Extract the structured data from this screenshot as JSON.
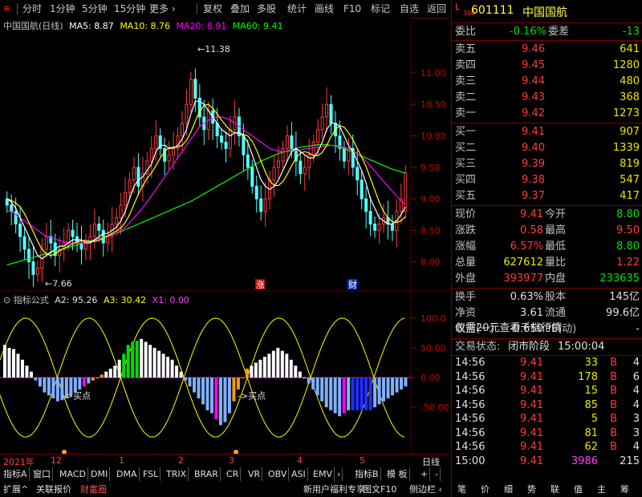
{
  "topbar": {
    "items": [
      "分时",
      "1分钟",
      "5分钟",
      "15分钟",
      "更多 ›",
      "复权",
      "叠加",
      "多股",
      "统计",
      "画线",
      "F10",
      "标记",
      "自选",
      "返回"
    ]
  },
  "chart_title": {
    "name": "中国国航(日线)",
    "ma5": "MA5: 8.87",
    "ma10": "MA10: 8.76",
    "ma20": "MA20: 8.91",
    "ma60": "MA60: 9.41",
    "color_ma5": "#ffffff",
    "color_ma10": "#ffff00",
    "color_ma20": "#ff00ff",
    "color_ma60": "#00ff00"
  },
  "price_axis": [
    "11.00",
    "10.50",
    "10.00",
    "9.50",
    "9.00",
    "8.50",
    "8.00"
  ],
  "annotations": {
    "high": "11.38",
    "low": "7.66",
    "zhang": "涨",
    "cai": "财"
  },
  "indicator": {
    "title": "指标公式",
    "a2": "A2: 95.26",
    "a3": "A3: 30.42",
    "x1": "X1: 0.00",
    "buy1": "->买点",
    "buy2": "->买点",
    "axis": [
      "100.0",
      "50.00",
      "0.00",
      "-50.00"
    ]
  },
  "dates": {
    "year": "2021年",
    "m12": "12",
    "m1": "1",
    "m2": "2",
    "m3": "3",
    "m4": "4",
    "m5": "5",
    "daily": "日线"
  },
  "bottom": {
    "row1": [
      "指标A",
      "窗口",
      "MACD",
      "DMI",
      "DMA",
      "FSL",
      "TRIX",
      "BRAR",
      "CR",
      "VR",
      "OBV",
      "ASI",
      "EMV",
      "›",
      "指标B",
      "模 板",
      "+",
      "-"
    ],
    "row2": [
      "扩展^",
      "关联报价",
      "财富圈",
      "新用户福利专享",
      "图文F10",
      "侧边栏 ‹"
    ],
    "row2_right": [
      "笔",
      "价",
      "细",
      "势",
      "联",
      "值",
      "主",
      "筹"
    ]
  },
  "quote": {
    "code": "601111",
    "name": "中国国航",
    "badge_top": "L",
    "badge_bot": "300",
    "weibi_lbl": "委比",
    "weibi": "-0.16%",
    "weicha_lbl": "委差",
    "weicha": "-13",
    "sells": [
      {
        "lbl": "卖五",
        "price": "9.46",
        "vol": "641"
      },
      {
        "lbl": "卖四",
        "price": "9.45",
        "vol": "1280"
      },
      {
        "lbl": "卖三",
        "price": "9.44",
        "vol": "480"
      },
      {
        "lbl": "卖二",
        "price": "9.43",
        "vol": "368"
      },
      {
        "lbl": "卖一",
        "price": "9.42",
        "vol": "1273"
      }
    ],
    "buys": [
      {
        "lbl": "买一",
        "price": "9.41",
        "vol": "907"
      },
      {
        "lbl": "买二",
        "price": "9.40",
        "vol": "1339"
      },
      {
        "lbl": "买三",
        "price": "9.39",
        "vol": "819"
      },
      {
        "lbl": "买四",
        "price": "9.38",
        "vol": "547"
      },
      {
        "lbl": "买五",
        "price": "9.37",
        "vol": "417"
      }
    ],
    "stats": [
      {
        "l1": "现价",
        "v1": "9.41",
        "c1": "red",
        "l2": "今开",
        "v2": "8.80",
        "c2": "green"
      },
      {
        "l1": "涨跌",
        "v1": "0.58",
        "c1": "red",
        "l2": "最高",
        "v2": "9.50",
        "c2": "red"
      },
      {
        "l1": "涨幅",
        "v1": "6.57%",
        "c1": "red",
        "l2": "最低",
        "v2": "8.80",
        "c2": "green"
      },
      {
        "l1": "总量",
        "v1": "627612",
        "c1": "yellow",
        "l2": "量比",
        "v2": "1.22",
        "c2": "red"
      },
      {
        "l1": "外盘",
        "v1": "393977",
        "c1": "red",
        "l2": "内盘",
        "v2": "233635",
        "c2": "green"
      }
    ],
    "stats2": [
      {
        "l1": "换手",
        "v1": "0.63%",
        "l2": "股本",
        "v2": "145亿"
      },
      {
        "l1": "净资",
        "v1": "3.61",
        "l2": "流通",
        "v2": "99.6亿"
      },
      {
        "l1": "收益(一)",
        "v1": "-0.650",
        "l2": "PE(动)",
        "v2": "-"
      }
    ],
    "promo": "仅需20元查看千档行情",
    "status_lbl": "交易状态:",
    "status": "闭市阶段",
    "status_time": "15:00:04",
    "ticks": [
      {
        "t": "14:56",
        "p": "9.41",
        "v": "33",
        "s": "B",
        "n": "4"
      },
      {
        "t": "14:56",
        "p": "9.41",
        "v": "178",
        "s": "B",
        "n": "6"
      },
      {
        "t": "14:56",
        "p": "9.41",
        "v": "15",
        "s": "B",
        "n": "4"
      },
      {
        "t": "14:56",
        "p": "9.41",
        "v": "85",
        "s": "B",
        "n": "4"
      },
      {
        "t": "14:56",
        "p": "9.41",
        "v": "5",
        "s": "B",
        "n": "3"
      },
      {
        "t": "14:56",
        "p": "9.41",
        "v": "81",
        "s": "B",
        "n": "3"
      },
      {
        "t": "14:56",
        "p": "9.41",
        "v": "62",
        "s": "B",
        "n": "4"
      },
      {
        "t": "15:00",
        "p": "9.41",
        "v": "3986",
        "s": "",
        "n": "215"
      }
    ]
  },
  "chart_data": {
    "type": "candlestick",
    "ylim": [
      7.6,
      11.7
    ],
    "closes": [
      8.9,
      8.8,
      8.6,
      8.4,
      8.2,
      8.0,
      7.8,
      7.9,
      8.2,
      8.4,
      8.3,
      8.1,
      8.2,
      8.3,
      8.5,
      8.4,
      8.3,
      8.2,
      8.3,
      8.4,
      8.6,
      8.5,
      8.3,
      8.4,
      8.6,
      8.7,
      8.9,
      9.1,
      9.3,
      9.5,
      9.2,
      9.4,
      9.6,
      9.8,
      10.0,
      9.8,
      9.6,
      9.7,
      9.8,
      10.0,
      10.2,
      10.5,
      10.9,
      10.6,
      10.3,
      10.1,
      10.4,
      10.2,
      10.0,
      9.9,
      9.8,
      10.1,
      10.3,
      10.0,
      9.7,
      9.5,
      9.2,
      9.0,
      8.8,
      9.0,
      9.3,
      9.5,
      9.6,
      9.8,
      10.0,
      9.8,
      9.6,
      9.4,
      9.5,
      9.7,
      9.9,
      10.1,
      10.3,
      10.5,
      10.2,
      10.0,
      9.8,
      9.6,
      9.8,
      9.5,
      9.3,
      9.0,
      8.8,
      8.6,
      8.5,
      8.6,
      8.7,
      8.6,
      8.5,
      8.8,
      9.0,
      9.41
    ],
    "opens": [
      9.0,
      8.9,
      8.8,
      8.6,
      8.4,
      8.2,
      8.0,
      7.8,
      7.9,
      8.2,
      8.4,
      8.3,
      8.1,
      8.2,
      8.3,
      8.5,
      8.4,
      8.3,
      8.2,
      8.3,
      8.4,
      8.6,
      8.5,
      8.3,
      8.4,
      8.6,
      8.7,
      8.9,
      9.1,
      9.3,
      9.5,
      9.2,
      9.4,
      9.6,
      9.8,
      10.0,
      9.8,
      9.6,
      9.7,
      9.8,
      10.0,
      10.2,
      10.5,
      10.9,
      10.6,
      10.3,
      10.1,
      10.4,
      10.2,
      10.0,
      9.9,
      9.8,
      10.1,
      10.3,
      10.0,
      9.7,
      9.5,
      9.2,
      9.0,
      8.8,
      9.0,
      9.3,
      9.5,
      9.6,
      9.8,
      10.0,
      9.8,
      9.6,
      9.4,
      9.5,
      9.7,
      9.9,
      10.1,
      10.3,
      10.5,
      10.2,
      10.0,
      9.8,
      9.6,
      9.8,
      9.5,
      9.3,
      9.0,
      8.8,
      8.6,
      8.5,
      8.6,
      8.7,
      8.6,
      8.5,
      8.8,
      8.8
    ],
    "ma5": [
      9.0,
      8.95,
      8.85,
      8.7,
      8.55,
      8.4,
      8.25,
      8.1,
      8.05,
      8.1,
      8.15,
      8.2,
      8.25,
      8.25,
      8.3,
      8.35,
      8.35,
      8.35,
      8.3,
      8.3,
      8.35,
      8.4,
      8.45,
      8.45,
      8.5,
      8.55,
      8.65,
      8.8,
      9.0,
      9.2,
      9.3,
      9.35,
      9.45,
      9.55,
      9.75,
      9.85,
      9.85,
      9.8,
      9.8,
      9.85,
      9.95,
      10.1,
      10.35,
      10.55,
      10.55,
      10.5,
      10.4,
      10.3,
      10.2,
      10.1,
      10.05,
      10.0,
      10.05,
      10.05,
      10.0,
      9.9,
      9.7,
      9.5,
      9.3,
      9.2,
      9.15,
      9.2,
      9.3,
      9.45,
      9.6,
      9.75,
      9.8,
      9.75,
      9.7,
      9.65,
      9.65,
      9.75,
      9.9,
      10.1,
      10.2,
      10.2,
      10.15,
      10.0,
      9.85,
      9.75,
      9.6,
      9.45,
      9.25,
      9.0,
      8.85,
      8.7,
      8.65,
      8.6,
      8.6,
      8.65,
      8.75,
      8.87
    ],
    "ma20": [
      8.8,
      8.8,
      8.75,
      8.7,
      8.65,
      8.6,
      8.55,
      8.5,
      8.45,
      8.4,
      8.38,
      8.36,
      8.34,
      8.32,
      8.3,
      8.3,
      8.3,
      8.3,
      8.3,
      8.32,
      8.34,
      8.36,
      8.38,
      8.4,
      8.42,
      8.45,
      8.5,
      8.55,
      8.62,
      8.7,
      8.78,
      8.86,
      8.95,
      9.05,
      9.15,
      9.25,
      9.35,
      9.45,
      9.55,
      9.65,
      9.75,
      9.85,
      9.95,
      10.05,
      10.15,
      10.2,
      10.25,
      10.28,
      10.3,
      10.3,
      10.28,
      10.25,
      10.2,
      10.15,
      10.1,
      10.05,
      10.0,
      9.95,
      9.9,
      9.85,
      9.8,
      9.78,
      9.76,
      9.75,
      9.75,
      9.76,
      9.77,
      9.78,
      9.79,
      9.8,
      9.81,
      9.82,
      9.83,
      9.84,
      9.85,
      9.85,
      9.84,
      9.82,
      9.8,
      9.76,
      9.72,
      9.66,
      9.6,
      9.52,
      9.44,
      9.36,
      9.28,
      9.2,
      9.12,
      9.04,
      8.97,
      8.91
    ],
    "ma60": [
      7.95,
      7.97,
      7.99,
      8.01,
      8.03,
      8.05,
      8.07,
      8.09,
      8.11,
      8.13,
      8.15,
      8.17,
      8.19,
      8.21,
      8.23,
      8.25,
      8.27,
      8.29,
      8.31,
      8.33,
      8.35,
      8.37,
      8.39,
      8.41,
      8.43,
      8.45,
      8.48,
      8.51,
      8.54,
      8.57,
      8.6,
      8.63,
      8.66,
      8.69,
      8.72,
      8.75,
      8.78,
      8.81,
      8.84,
      8.87,
      8.9,
      8.93,
      8.96,
      9.0,
      9.04,
      9.08,
      9.12,
      9.16,
      9.2,
      9.24,
      9.28,
      9.32,
      9.36,
      9.4,
      9.44,
      9.48,
      9.52,
      9.56,
      9.6,
      9.63,
      9.66,
      9.69,
      9.72,
      9.74,
      9.76,
      9.78,
      9.8,
      9.82,
      9.83,
      9.84,
      9.85,
      9.86,
      9.86,
      9.86,
      9.85,
      9.84,
      9.82,
      9.8,
      9.77,
      9.74,
      9.71,
      9.68,
      9.65,
      9.62,
      9.59,
      9.56,
      9.53,
      9.5,
      9.47,
      9.45,
      9.43,
      9.41
    ],
    "indicator_bars": [
      55,
      50,
      48,
      40,
      30,
      20,
      10,
      -5,
      -15,
      -25,
      -30,
      -35,
      -40,
      -38,
      -35,
      -30,
      -25,
      -20,
      -15,
      -10,
      -5,
      0,
      5,
      10,
      15,
      20,
      30,
      40,
      55,
      60,
      62,
      65,
      60,
      55,
      50,
      45,
      40,
      35,
      30,
      20,
      10,
      -5,
      -15,
      -25,
      -35,
      -45,
      -55,
      -60,
      -70,
      -80,
      -75,
      -60,
      -40,
      -20,
      0,
      15,
      20,
      25,
      30,
      35,
      40,
      45,
      50,
      45,
      40,
      30,
      20,
      10,
      0,
      -10,
      -20,
      -30,
      -40,
      -50,
      -55,
      -60,
      -65,
      -60,
      -55,
      -55,
      -55,
      -55,
      -55,
      -55,
      -50,
      -45,
      -40,
      -35,
      -30,
      -25,
      -20,
      -15
    ]
  }
}
